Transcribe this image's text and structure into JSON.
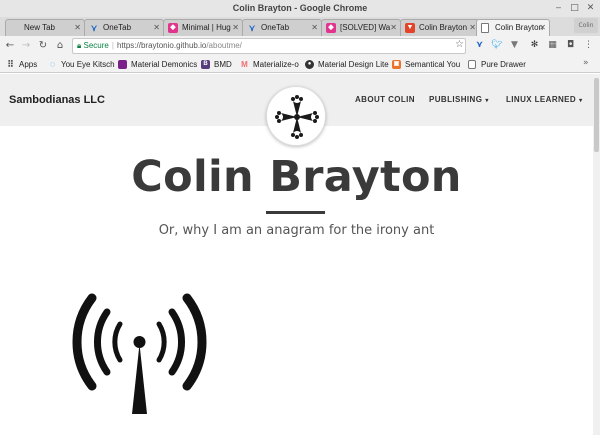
{
  "window": {
    "title": "Colin Brayton - Google Chrome",
    "controls": [
      "minimize-icon",
      "maximize-icon",
      "close-icon"
    ]
  },
  "tabs": [
    {
      "label": "New Tab",
      "icon": "none",
      "active": false
    },
    {
      "label": "OneTab",
      "icon": "onetab-icon",
      "active": false
    },
    {
      "label": "Minimal | Hug",
      "icon": "pink-hexagon-icon",
      "active": false
    },
    {
      "label": "OneTab",
      "icon": "onetab-icon",
      "active": false
    },
    {
      "label": "[SOLVED] Wa",
      "icon": "pink-hexagon-icon",
      "active": false
    },
    {
      "label": "Colin Brayton",
      "icon": "gitlab-fox-icon",
      "active": false
    },
    {
      "label": "Colin Brayton",
      "icon": "page-icon",
      "active": true
    }
  ],
  "profile_badge": "Colin",
  "toolbar": {
    "secure_label": "Secure",
    "url_host": "https://braytonio.github.io",
    "url_path": "/aboutme/"
  },
  "bookmarks": [
    {
      "label": "Apps",
      "icon": "apps-grid-icon"
    },
    {
      "label": "You Eye Kitsch",
      "icon": "spinner-icon"
    },
    {
      "label": "Material Demonics",
      "icon": "purple-square-icon"
    },
    {
      "label": "BMD",
      "icon": "bootstrap-b-icon"
    },
    {
      "label": "Materialize-o",
      "icon": "materialize-m-icon"
    },
    {
      "label": "Material Design Lite",
      "icon": "github-icon"
    },
    {
      "label": "Semantical You",
      "icon": "orange-square-icon"
    },
    {
      "label": "Pure Drawer",
      "icon": "page-icon"
    }
  ],
  "site": {
    "brand": "Sambodianas LLC",
    "nav": [
      {
        "label": "ABOUT COLIN",
        "has_caret": false
      },
      {
        "label": "PUBLISHING",
        "has_caret": true,
        "caret": "▾"
      },
      {
        "label": "LINUX LEARNED",
        "has_caret": true,
        "caret": "▾"
      }
    ],
    "logo": "occitan-cross-icon",
    "hero_title": "Colin Brayton",
    "hero_subtitle": "Or, why I am an anagram for the irony ant",
    "feature_icon": "radio-tower-icon"
  },
  "colors": {
    "title_text": "#3a3a3a",
    "nav_bg": "#efefef",
    "secure_green": "#0b8043",
    "twitter_blue": "#1da1f2"
  }
}
